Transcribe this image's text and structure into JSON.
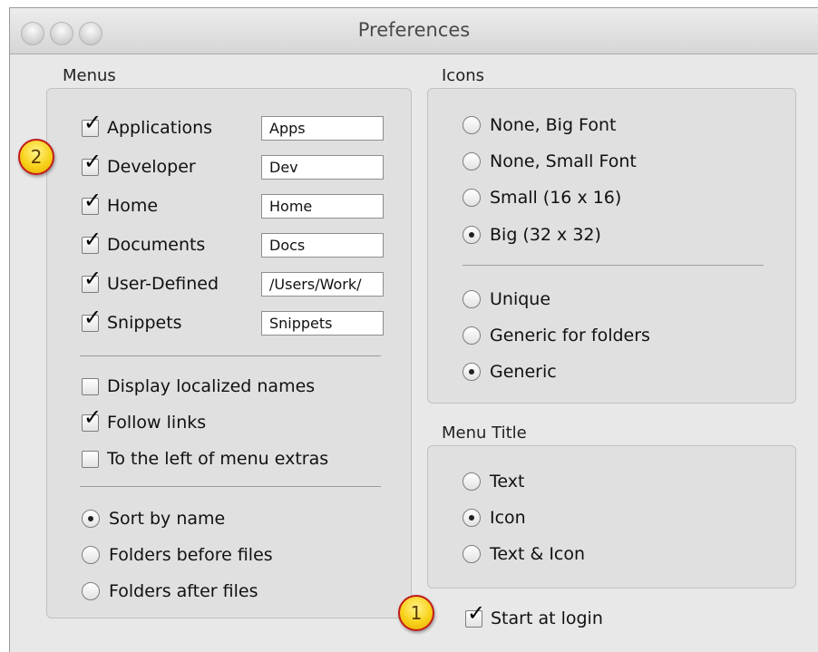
{
  "window": {
    "title": "Preferences"
  },
  "menus": {
    "label": "Menus",
    "items": [
      {
        "label": "Applications",
        "checked": true,
        "field": "Apps"
      },
      {
        "label": "Developer",
        "checked": true,
        "field": "Dev"
      },
      {
        "label": "Home",
        "checked": true,
        "field": "Home"
      },
      {
        "label": "Documents",
        "checked": true,
        "field": "Docs"
      },
      {
        "label": "User-Defined",
        "checked": true,
        "field": "/Users/Work/"
      },
      {
        "label": "Snippets",
        "checked": true,
        "field": "Snippets"
      }
    ],
    "options": [
      {
        "label": "Display localized names",
        "checked": false
      },
      {
        "label": "Follow links",
        "checked": true
      },
      {
        "label": "To the left of menu extras",
        "checked": false
      }
    ],
    "sort": [
      {
        "label": "Sort by name",
        "selected": true
      },
      {
        "label": "Folders before files",
        "selected": false
      },
      {
        "label": "Folders after files",
        "selected": false
      }
    ]
  },
  "icons": {
    "label": "Icons",
    "size": [
      {
        "label": "None, Big Font",
        "selected": false
      },
      {
        "label": "None, Small Font",
        "selected": false
      },
      {
        "label": "Small (16 x 16)",
        "selected": false
      },
      {
        "label": "Big (32 x 32)",
        "selected": true
      }
    ],
    "style": [
      {
        "label": "Unique",
        "selected": false
      },
      {
        "label": "Generic for folders",
        "selected": false
      },
      {
        "label": "Generic",
        "selected": true
      }
    ]
  },
  "menu_title": {
    "label": "Menu Title",
    "options": [
      {
        "label": "Text",
        "selected": false
      },
      {
        "label": "Icon",
        "selected": true
      },
      {
        "label": "Text & Icon",
        "selected": false
      }
    ]
  },
  "start_at_login": {
    "label": "Start at login",
    "checked": true
  },
  "callouts": {
    "one": "1",
    "two": "2"
  },
  "colors": {
    "window_bg": "#e8e8e8",
    "group_bg": "#e0e0e0",
    "badge_fill": "#f8d21a",
    "badge_border": "#c21a1a"
  }
}
